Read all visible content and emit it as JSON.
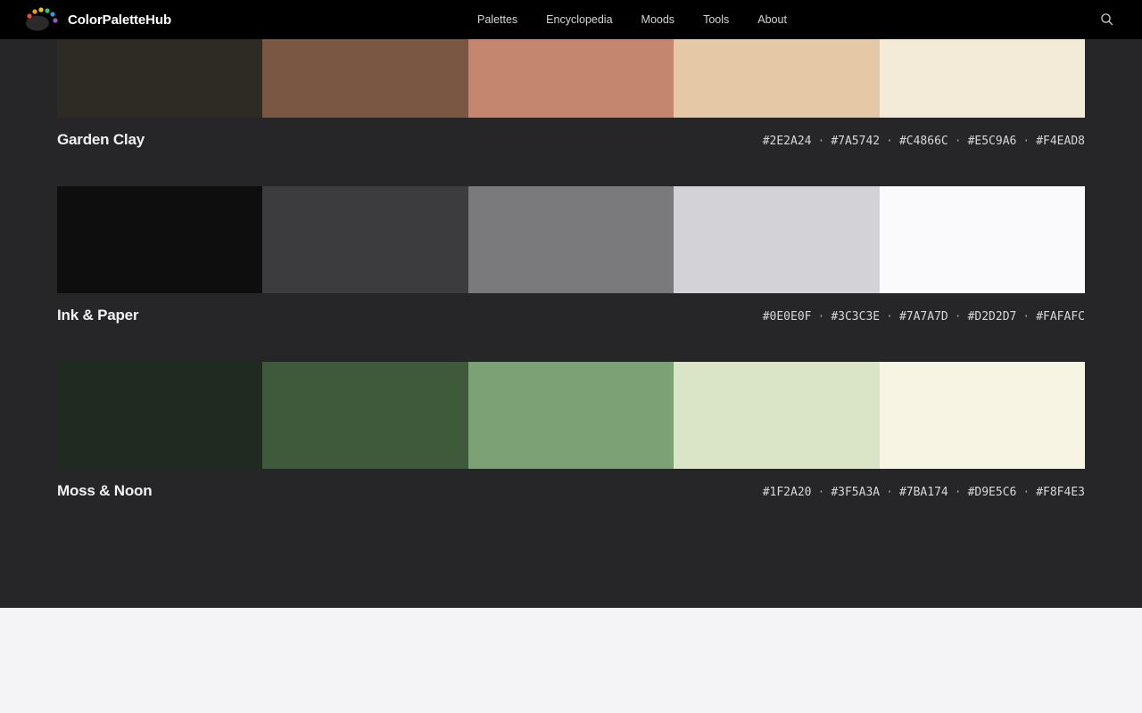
{
  "header": {
    "brand": "ColorPaletteHub",
    "nav": [
      "Palettes",
      "Encyclopedia",
      "Moods",
      "Tools",
      "About"
    ],
    "search_icon": "search-icon"
  },
  "colors": {
    "navbar_bg": "#000000",
    "page_bg": "#262629",
    "footer_bg": "#F4F4F6"
  },
  "palettes": [
    {
      "name": "Garden Clay",
      "colors": [
        "#2E2A24",
        "#7A5742",
        "#C4866C",
        "#E5C9A6",
        "#F4EAD8"
      ]
    },
    {
      "name": "Ink & Paper",
      "colors": [
        "#0E0E0F",
        "#3C3C3E",
        "#7A7A7D",
        "#D2D2D7",
        "#FAFAFC"
      ]
    },
    {
      "name": "Moss & Noon",
      "colors": [
        "#1F2A20",
        "#3F5A3A",
        "#7BA174",
        "#D9E5C6",
        "#F8F4E3"
      ]
    }
  ]
}
